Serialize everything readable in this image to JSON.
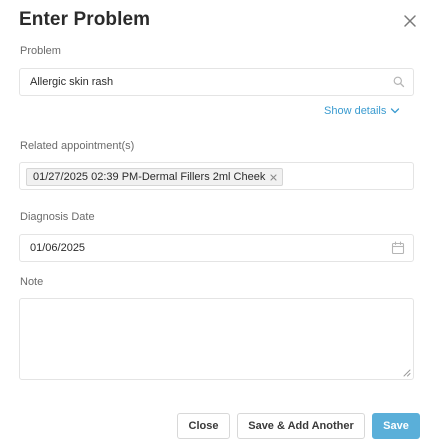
{
  "dialog": {
    "title": "Enter Problem",
    "close_icon": "close-icon"
  },
  "problem": {
    "label": "Problem",
    "value": "Allergic skin rash",
    "icon": "search-icon"
  },
  "show_details": {
    "label": "Show details",
    "icon": "chevron-down-icon"
  },
  "related": {
    "label": "Related appointment(s)",
    "chips": [
      "01/27/2025 02:39 PM-Dermal Fillers 2ml Cheek"
    ]
  },
  "diagnosis_date": {
    "label": "Diagnosis Date",
    "value": "01/06/2025",
    "icon": "calendar-icon"
  },
  "note": {
    "label": "Note",
    "value": ""
  },
  "buttons": {
    "close": "Close",
    "save_add_another": "Save & Add Another",
    "save": "Save"
  },
  "colors": {
    "accent": "#5aafd9",
    "link": "#3a9bd0",
    "border": "#e4e4e4"
  }
}
